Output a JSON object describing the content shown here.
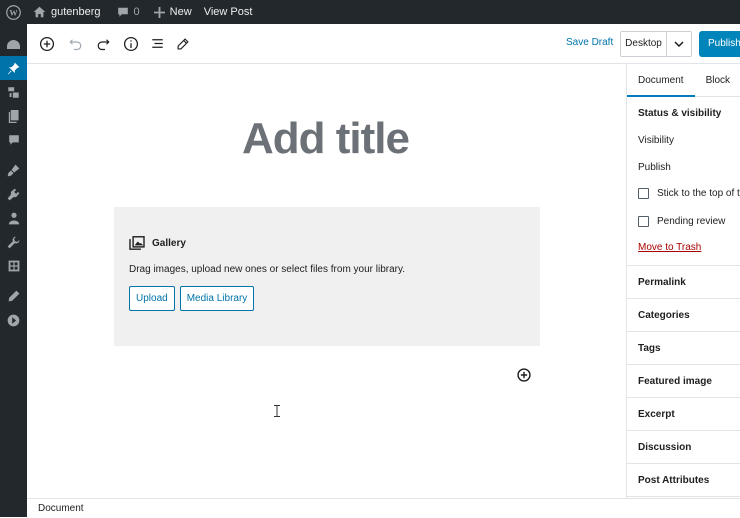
{
  "adminbar": {
    "site_name": "gutenberg",
    "comments_count": "0",
    "new_label": "New",
    "view_post_label": "View Post"
  },
  "toolbar": {
    "save_draft_label": "Save Draft",
    "device_label": "Desktop",
    "publish_label": "Publish"
  },
  "editor": {
    "title_placeholder": "Add title",
    "gallery": {
      "title": "Gallery",
      "description": "Drag images, upload new ones or select files from your library.",
      "upload_label": "Upload",
      "media_library_label": "Media Library"
    }
  },
  "panel": {
    "tabs": [
      "Document",
      "Block"
    ],
    "status": {
      "heading": "Status & visibility",
      "visibility_label": "Visibility",
      "publish_label": "Publish",
      "stick_label": "Stick to the top of t",
      "pending_label": "Pending review",
      "trash_label": "Move to Trash"
    },
    "sections": [
      "Permalink",
      "Categories",
      "Tags",
      "Featured image",
      "Excerpt",
      "Discussion",
      "Post Attributes"
    ]
  },
  "footer": {
    "breadcrumb": "Document"
  },
  "colors": {
    "accent": "#0073aa",
    "publish_bg": "#0085ba",
    "admin_bg": "#23282d",
    "trash": "#aa0000"
  }
}
